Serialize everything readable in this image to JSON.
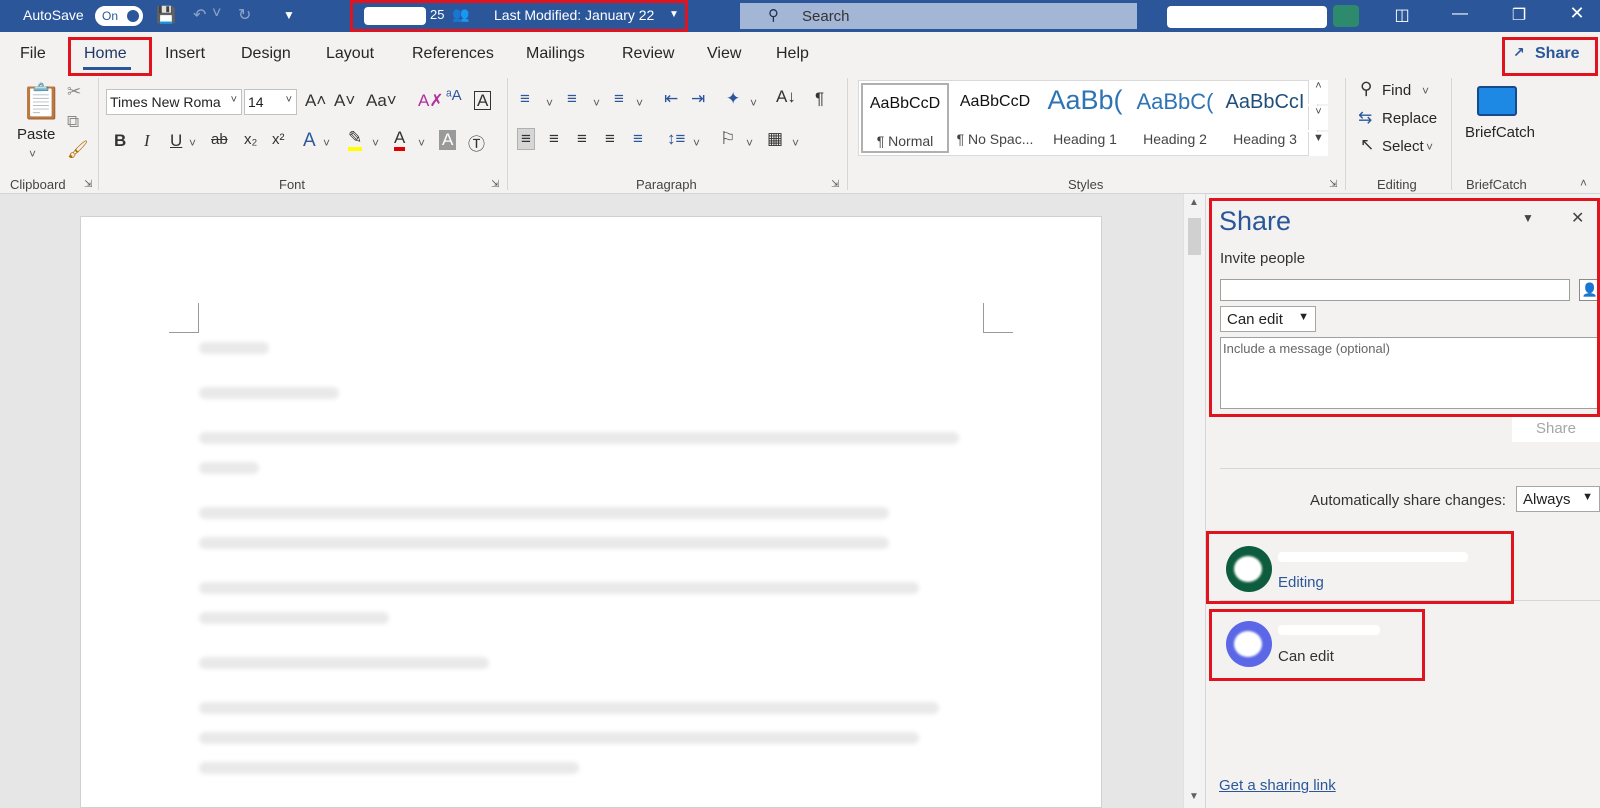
{
  "titlebar": {
    "autosave_label": "AutoSave",
    "autosave_state": "On",
    "doc_suffix": "25",
    "last_modified": "Last Modified: January 22",
    "search_placeholder": "Search"
  },
  "tabs": [
    "File",
    "Home",
    "Insert",
    "Design",
    "Layout",
    "References",
    "Mailings",
    "Review",
    "View",
    "Help"
  ],
  "active_tab": "Home",
  "share_button": "Share",
  "clipboard": {
    "paste": "Paste",
    "group": "Clipboard"
  },
  "font": {
    "name": "Times New Roma",
    "size": "14",
    "group": "Font"
  },
  "paragraph": {
    "group": "Paragraph"
  },
  "styles": {
    "group": "Styles",
    "items": [
      {
        "sample": "AaBbCcD",
        "name": "¶ Normal"
      },
      {
        "sample": "AaBbCcD",
        "name": "¶ No Spac..."
      },
      {
        "sample": "AaBb(",
        "name": "Heading 1"
      },
      {
        "sample": "AaBbC(",
        "name": "Heading 2"
      },
      {
        "sample": "AaBbCcI",
        "name": "Heading 3"
      }
    ]
  },
  "editing": {
    "find": "Find",
    "replace": "Replace",
    "select": "Select",
    "group": "Editing"
  },
  "briefcatch": {
    "label": "BriefCatch",
    "group": "BriefCatch"
  },
  "share_pane": {
    "title": "Share",
    "invite_label": "Invite people",
    "permission": "Can edit",
    "message_placeholder": "Include a message (optional)",
    "share_button": "Share",
    "auto_share_label": "Automatically share changes:",
    "auto_share_value": "Always",
    "users": [
      {
        "status": "Editing",
        "status_color": "#2b579a"
      },
      {
        "status": "Can edit",
        "status_color": "#333333"
      }
    ],
    "sharing_link": "Get a sharing link"
  },
  "colors": {
    "accent": "#2b579a",
    "annotation": "#e0141e"
  }
}
